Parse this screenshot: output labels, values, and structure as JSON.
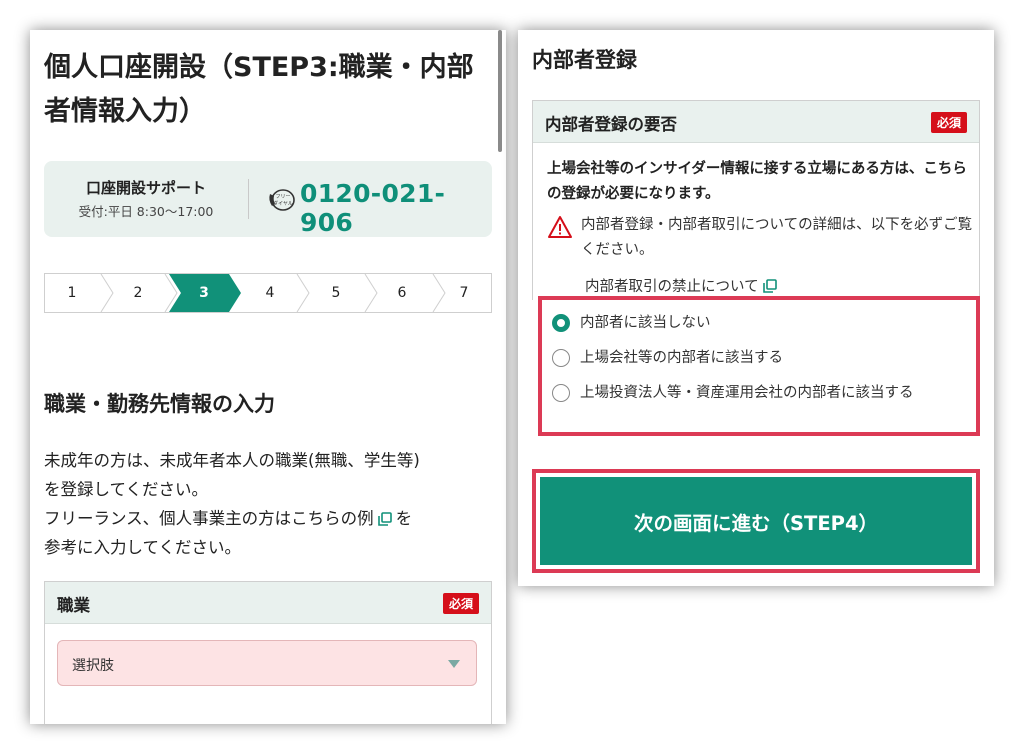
{
  "left": {
    "page_title": "個人口座開設（STEP3:職業・内部者情報入力）",
    "support": {
      "title": "口座開設サポート",
      "hours": "受付:平日 8:30〜17:00",
      "phone": "0120-021-906",
      "phone_icon_text": "フリーダイヤル"
    },
    "steps": [
      "1",
      "2",
      "3",
      "4",
      "5",
      "6",
      "7"
    ],
    "active_step": "3",
    "section_title": "職業・勤務先情報の入力",
    "desc1_line1": "未成年の方は、未成年者本人の職業(無職、学生等)",
    "desc1_line2": "を登録してください。",
    "desc2_pre": "フリーランス、個人事業主の方はこちらの例",
    "desc2_post": "を",
    "desc2_line2": "参考に入力してください。",
    "occupation": {
      "label": "職業",
      "required": "必須",
      "select_value": "選択肢"
    }
  },
  "right": {
    "title": "内部者登録",
    "card_label": "内部者登録の要否",
    "required": "必須",
    "lead": "上場会社等のインサイダー情報に接する立場にある方は、こちらの登録が必要になります。",
    "warning": "内部者登録・内部者取引についての詳細は、以下を必ずご覧ください。",
    "link": "内部者取引の禁止について",
    "options": [
      "内部者に該当しない",
      "上場会社等の内部者に該当する",
      "上場投資法人等・資産運用会社の内部者に該当する"
    ],
    "selected_option": 0,
    "next_button": "次の画面に進む（STEP4）"
  },
  "colors": {
    "accent": "#119179",
    "phone": "#0f8f79",
    "required_badge": "#d50f1a",
    "highlight_border": "#dc3a55",
    "card_header": "#e9f1ee",
    "select_bg": "#fde3e4"
  }
}
